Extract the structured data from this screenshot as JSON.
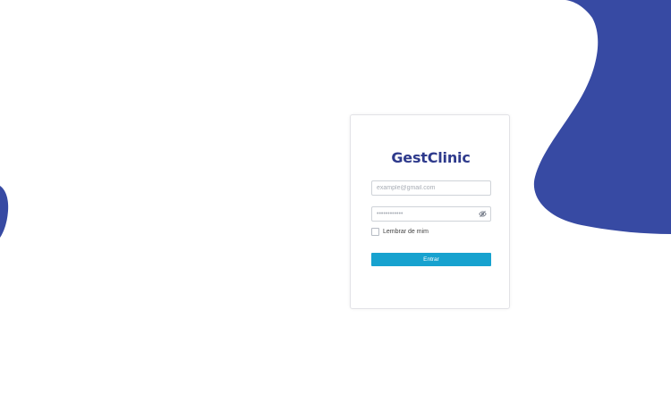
{
  "brand": {
    "title": "GestClinic"
  },
  "login": {
    "email_placeholder": "example@gmail.com",
    "email_value": "",
    "password_placeholder": "••••••••••••",
    "password_value": "",
    "remember_label": "Lembrar de mim",
    "submit_label": "Entrar"
  },
  "icons": {
    "password_toggle": "eye-off-icon",
    "checkbox": "checkbox-unchecked"
  },
  "colors": {
    "brand_text": "#2e3a8c",
    "decor_blob": "#374aa3",
    "submit_button": "#17a2cf",
    "background": "#ffffff"
  }
}
